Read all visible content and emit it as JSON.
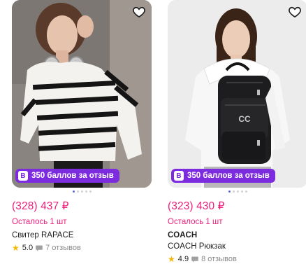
{
  "products": [
    {
      "badge": "350 баллов за отзыв",
      "badge_icon": "В",
      "price": "(328) 437 ₽",
      "remaining": "Осталось 1 шт",
      "title": "Свитер RAPACE",
      "rating": "5.0",
      "reviews": "7 отзывов"
    },
    {
      "badge": "350 баллов за отзыв",
      "badge_icon": "В",
      "price": "(323) 430 ₽",
      "remaining": "Осталось 1 шт",
      "brand": "COACH",
      "title": "COACH Рюкзак",
      "rating": "4.9",
      "reviews": "8 отзывов"
    }
  ],
  "colors": {
    "accent": "#ee1f7a",
    "badge": "#7d2bde",
    "star": "#f5b50a",
    "dot_active": "#5b6fd6"
  }
}
